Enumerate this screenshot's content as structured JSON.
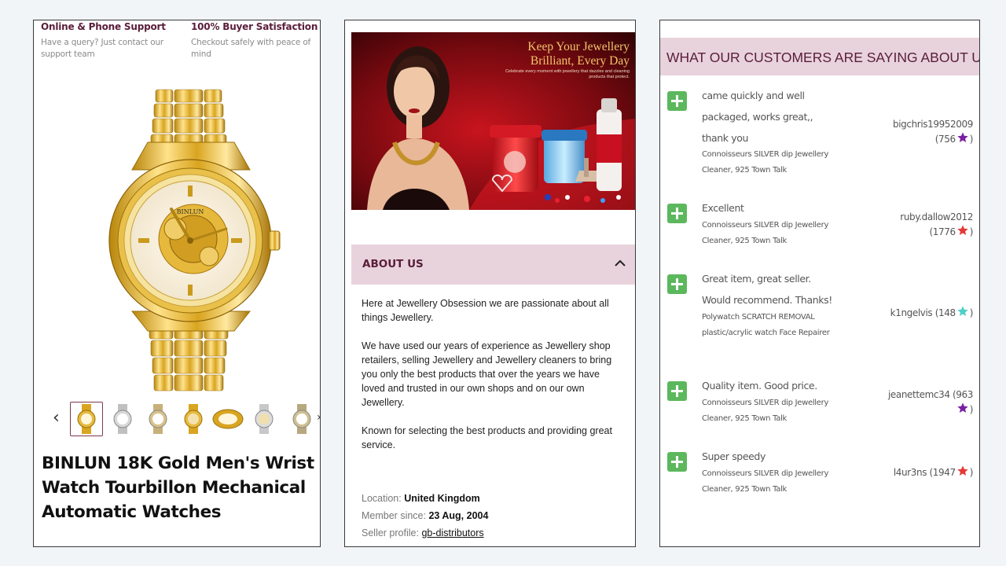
{
  "colors": {
    "accent": "#5a1d3a",
    "header_bg": "#e8d3dc",
    "plus_green": "#5cb85c",
    "star_purple": "#7b1fa2",
    "star_red": "#e53935",
    "star_turquoise": "#4dd0c8"
  },
  "support": {
    "online_title": "Online & Phone Support",
    "online_text": "Have a query? Just contact our support team",
    "satisfaction_title": "100% Buyer Satisfaction",
    "satisfaction_text": "Checkout safely with peace of mind"
  },
  "product": {
    "watch_brand": "BINLUN",
    "title": "BINLUN 18K Gold Men's Wrist Watch Tourbillon Mechanical Automatic Watches"
  },
  "banner": {
    "title_line1": "Keep Your Jewellery",
    "title_line2": "Brilliant, Every Day",
    "subtitle": "Celebrate every moment with jewellery that dazzles and cleaning products that protect."
  },
  "about": {
    "heading": "ABOUT US",
    "paragraphs": [
      "Here at Jewellery Obsession we are passionate about all things Jewellery.",
      "We have used our years of experience as Jewellery shop retailers, selling Jewellery and Jewellery cleaners to bring you only the best products that over the years we have loved and trusted in our own shops and on our own Jewellery.",
      "Known for selecting the best products and providing great service."
    ],
    "location_label": "Location:",
    "location": "United Kingdom",
    "member_label": "Member since:",
    "member_since": "23 Aug, 2004",
    "profile_label": "Seller profile:",
    "profile": "gb-distributors"
  },
  "reviews": {
    "heading": "WHAT OUR CUSTOMERS ARE SAYING ABOUT US",
    "items": [
      {
        "text": "came quickly and well packaged, works great,, thank you",
        "item": "Connoisseurs SILVER dip Jewellery Cleaner, 925 Town Talk",
        "user": "bigchris19952009",
        "score": "(756",
        "star": "purple"
      },
      {
        "text": "Excellent",
        "item": "Connoisseurs SILVER dip Jewellery Cleaner, 925 Town Talk",
        "user": "ruby.dallow2012",
        "score": "(1776",
        "star": "red"
      },
      {
        "text": "Great item, great seller. Would recommend. Thanks!",
        "item": "Polywatch SCRATCH REMOVAL plastic/acrylic watch Face Repairer",
        "user": "k1ngelvis",
        "score": "(148",
        "star": "turquoise"
      },
      {
        "text": "Quality item. Good price.",
        "item": "Connoisseurs SILVER dip Jewellery Cleaner, 925 Town Talk",
        "user": "jeanettemc34",
        "score": "(963",
        "star": "purple"
      },
      {
        "text": "Super speedy",
        "item": "Connoisseurs SILVER dip Jewellery Cleaner, 925 Town Talk",
        "user": "l4ur3ns",
        "score": "(1947",
        "star": "red"
      }
    ]
  }
}
